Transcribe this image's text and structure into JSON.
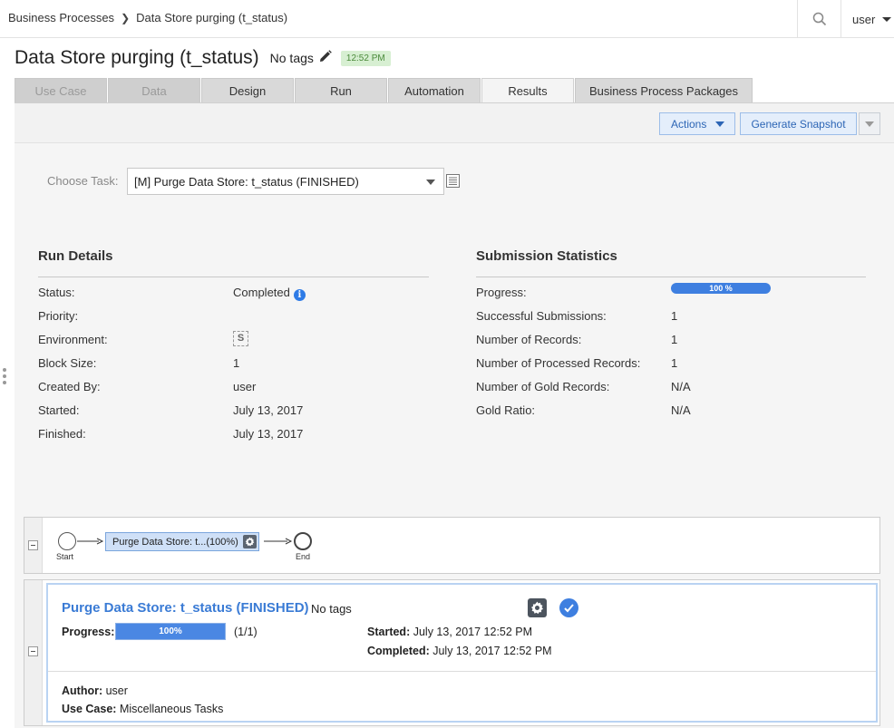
{
  "breadcrumb": {
    "parent": "Business Processes",
    "current": "Data Store purging (t_status)"
  },
  "user": {
    "name": "user"
  },
  "header": {
    "title": "Data Store purging (t_status)",
    "tags": "No tags",
    "time_badge": "12:52 PM"
  },
  "tabs": [
    {
      "label": "Use Case",
      "state": "disabled"
    },
    {
      "label": "Data",
      "state": "disabled"
    },
    {
      "label": "Design",
      "state": "normal"
    },
    {
      "label": "Run",
      "state": "normal"
    },
    {
      "label": "Automation",
      "state": "normal"
    },
    {
      "label": "Results",
      "state": "active"
    },
    {
      "label": "Business Process Packages",
      "state": "normal"
    }
  ],
  "toolbar": {
    "actions_label": "Actions",
    "snapshot_label": "Generate Snapshot"
  },
  "task_chooser": {
    "label": "Choose Task:",
    "value": "[M] Purge Data Store: t_status (FINISHED)"
  },
  "run_details": {
    "title": "Run Details",
    "rows": [
      {
        "label": "Status:",
        "value": "Completed"
      },
      {
        "label": "Priority:",
        "value": ""
      },
      {
        "label": "Environment:",
        "value": "S"
      },
      {
        "label": "Block Size:",
        "value": "1"
      },
      {
        "label": "Created By:",
        "value": "user"
      },
      {
        "label": "Started:",
        "value": "July 13, 2017"
      },
      {
        "label": "Finished:",
        "value": "July 13, 2017"
      }
    ]
  },
  "submission_stats": {
    "title": "Submission Statistics",
    "progress_label": "Progress:",
    "progress_text": "100 %",
    "progress_fraction": 1.0,
    "rows": [
      {
        "label": "Successful Submissions:",
        "value": "1"
      },
      {
        "label": "Number of Records:",
        "value": "1"
      },
      {
        "label": "Number of Processed Records:",
        "value": "1"
      },
      {
        "label": "Number of Gold Records:",
        "value": "N/A"
      },
      {
        "label": "Gold Ratio:",
        "value": "N/A"
      }
    ]
  },
  "flow": {
    "start_label": "Start",
    "node_label": "Purge Data Store: t...(100%)",
    "end_label": "End"
  },
  "task": {
    "title": "Purge Data Store: t_status (FINISHED)",
    "tags": "No tags",
    "progress_label": "Progress:",
    "progress_text": "100%",
    "progress_fraction": 1.0,
    "progress_count": "(1/1)",
    "started_label": "Started:",
    "started_value": "July 13, 2017 12:52 PM",
    "completed_label": "Completed:",
    "completed_value": "July 13, 2017 12:52 PM",
    "author_label": "Author:",
    "author_value": "user",
    "use_case_label": "Use Case:",
    "use_case_value": "Miscellaneous Tasks"
  },
  "colors": {
    "accent": "#3e7fe0",
    "link": "#3a7bd5",
    "badge_bg": "#d7efd2"
  }
}
